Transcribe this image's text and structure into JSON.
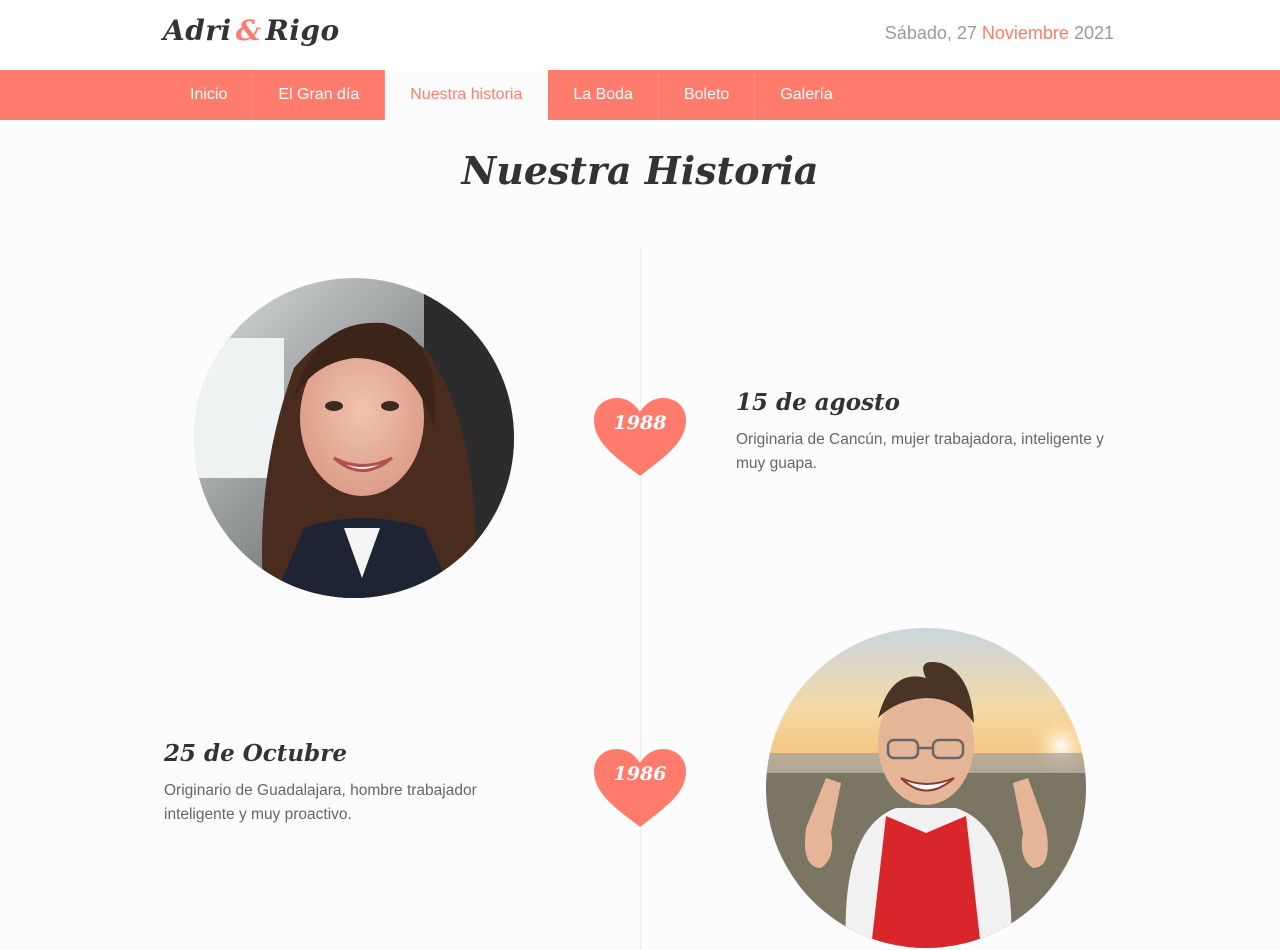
{
  "header": {
    "brand_first": "Adri",
    "brand_amp": "&",
    "brand_second": "Rigo",
    "date_prefix": "Sábado, 27",
    "date_month": "Noviembre",
    "date_year": "2021"
  },
  "nav": {
    "items": [
      {
        "label": "Inicio",
        "active": false
      },
      {
        "label": "El Gran día",
        "active": false
      },
      {
        "label": "Nuestra historia",
        "active": true
      },
      {
        "label": "La Boda",
        "active": false
      },
      {
        "label": "Boleto",
        "active": false
      },
      {
        "label": "Galería",
        "active": false
      }
    ]
  },
  "page": {
    "title": "Nuestra Historia"
  },
  "timeline": {
    "events": [
      {
        "year": "1988",
        "date": "15 de agosto",
        "text": "Originaria de Cancún, mujer trabajadora, inteligente y muy guapa.",
        "photo": "woman-portrait-photo"
      },
      {
        "year": "1986",
        "date": "25 de Octubre",
        "text": "Originario de Guadalajara, hombre trabajador inteligente y muy proactivo.",
        "photo": "man-portrait-photo"
      }
    ]
  },
  "colors": {
    "accent": "#ff7c6c",
    "background": "#fcfcfc",
    "text": "#333333"
  }
}
